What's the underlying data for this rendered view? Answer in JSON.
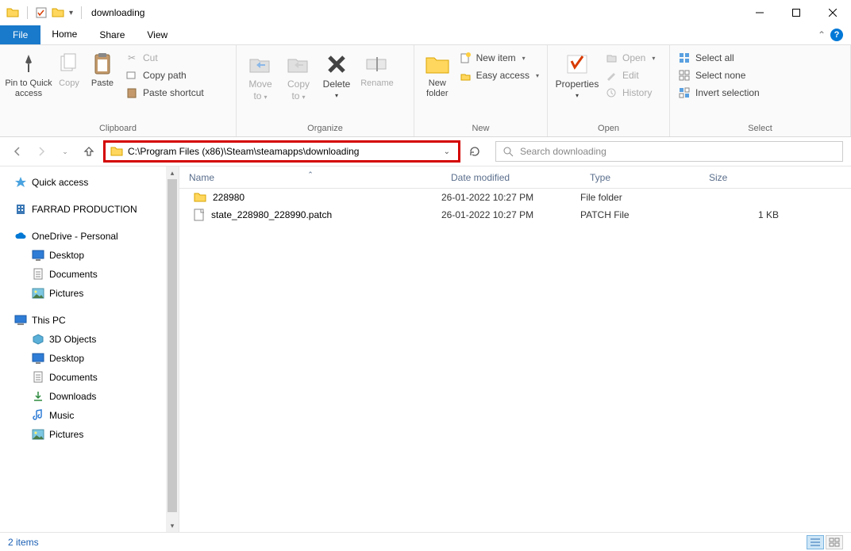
{
  "window": {
    "title": "downloading"
  },
  "menubar": {
    "file": "File",
    "tabs": [
      "Home",
      "Share",
      "View"
    ]
  },
  "ribbon": {
    "clipboard": {
      "label": "Clipboard",
      "pin": "Pin to Quick\naccess",
      "copy": "Copy",
      "paste": "Paste",
      "cut": "Cut",
      "copy_path": "Copy path",
      "paste_shortcut": "Paste shortcut"
    },
    "organize": {
      "label": "Organize",
      "move_to": "Move\nto",
      "copy_to": "Copy\nto",
      "delete": "Delete",
      "rename": "Rename"
    },
    "new": {
      "label": "New",
      "new_folder": "New\nfolder",
      "new_item": "New item",
      "easy_access": "Easy access"
    },
    "open": {
      "label": "Open",
      "properties": "Properties",
      "open": "Open",
      "edit": "Edit",
      "history": "History"
    },
    "select": {
      "label": "Select",
      "select_all": "Select all",
      "select_none": "Select none",
      "invert": "Invert selection"
    }
  },
  "address": {
    "path": "C:\\Program Files (x86)\\Steam\\steamapps\\downloading"
  },
  "search": {
    "placeholder": "Search downloading"
  },
  "nav": {
    "quick_access": "Quick access",
    "farrad": "FARRAD PRODUCTION",
    "onedrive": "OneDrive - Personal",
    "od_desktop": "Desktop",
    "od_documents": "Documents",
    "od_pictures": "Pictures",
    "this_pc": "This PC",
    "pc_3d": "3D Objects",
    "pc_desktop": "Desktop",
    "pc_documents": "Documents",
    "pc_downloads": "Downloads",
    "pc_music": "Music",
    "pc_pictures": "Pictures"
  },
  "columns": {
    "name": "Name",
    "date": "Date modified",
    "type": "Type",
    "size": "Size"
  },
  "files": [
    {
      "icon": "folder",
      "name": "228980",
      "date": "26-01-2022 10:27 PM",
      "type": "File folder",
      "size": ""
    },
    {
      "icon": "file",
      "name": "state_228980_228990.patch",
      "date": "26-01-2022 10:27 PM",
      "type": "PATCH File",
      "size": "1 KB"
    }
  ],
  "status": {
    "text": "2 items"
  }
}
